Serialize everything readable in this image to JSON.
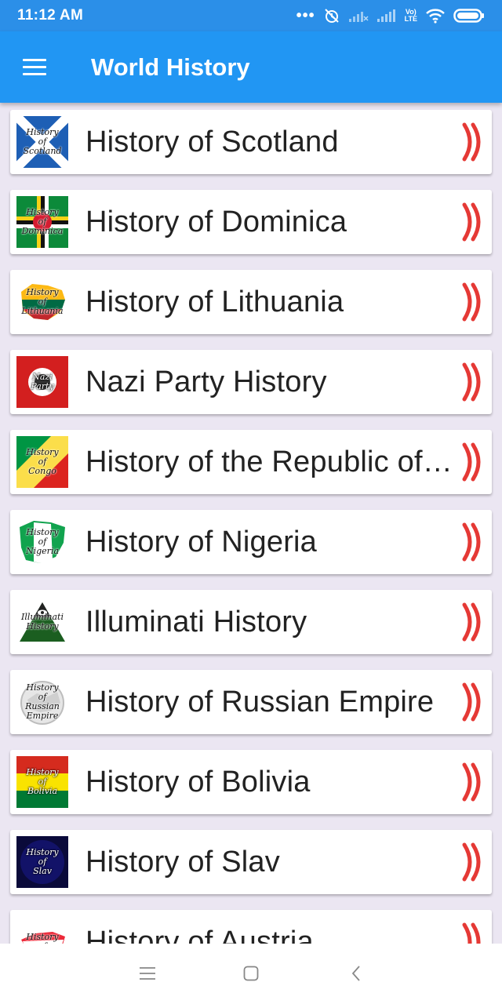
{
  "status_bar": {
    "time": "11:12 AM",
    "icons": [
      "more-dots-icon",
      "alarm-off-icon",
      "signal-weak-icon",
      "signal-icon",
      "volte-icon",
      "wifi-icon",
      "battery-icon"
    ],
    "lte_top": "Vo)",
    "lte_bottom": "LTE"
  },
  "app_bar": {
    "title": "World History",
    "menu_icon": "hamburger-menu-icon",
    "color": "#2196f3"
  },
  "list": {
    "chevron_color": "#e53935",
    "items": [
      {
        "label": "History of Scotland",
        "thumb_caption": [
          "History",
          "of",
          "Scotland"
        ]
      },
      {
        "label": "History of Dominica",
        "thumb_caption": [
          "History",
          "of",
          "Dominica"
        ]
      },
      {
        "label": "History of Lithuania",
        "thumb_caption": [
          "History",
          "of",
          "Lithuania"
        ]
      },
      {
        "label": "Nazi Party History",
        "thumb_caption": [
          "Nazi",
          "Party"
        ]
      },
      {
        "label": "History of the Republic of …",
        "thumb_caption": [
          "History",
          "of",
          "Congo"
        ]
      },
      {
        "label": "History of Nigeria",
        "thumb_caption": [
          "History",
          "of",
          "Nigeria"
        ]
      },
      {
        "label": "Illuminati History",
        "thumb_caption": [
          "Illuminati",
          "History"
        ]
      },
      {
        "label": "History of Russian Empire",
        "thumb_caption": [
          "History",
          "of",
          "Russian",
          "Empire"
        ]
      },
      {
        "label": "History of Bolivia",
        "thumb_caption": [
          "History",
          "of",
          "Bolivia"
        ]
      },
      {
        "label": "History of Slav",
        "thumb_caption": [
          "History",
          "of",
          "Slav"
        ]
      },
      {
        "label": "History of Austria",
        "thumb_caption": [
          "History",
          "of"
        ]
      }
    ]
  },
  "nav_bar": {
    "icons": [
      "recents-menu-icon",
      "home-square-icon",
      "back-chevron-icon"
    ]
  }
}
